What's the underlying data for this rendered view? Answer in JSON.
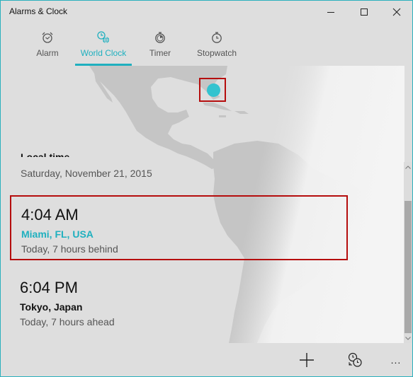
{
  "window": {
    "title": "Alarms & Clock",
    "controls": {
      "minimize": "minimize-icon",
      "maximize": "maximize-icon",
      "close": "close-icon"
    }
  },
  "tabs": [
    {
      "label": "Alarm",
      "icon": "alarm-clock-icon",
      "active": false
    },
    {
      "label": "World Clock",
      "icon": "world-clock-icon",
      "active": true
    },
    {
      "label": "Timer",
      "icon": "timer-icon",
      "active": false
    },
    {
      "label": "Stopwatch",
      "icon": "stopwatch-icon",
      "active": false
    }
  ],
  "map": {
    "marker_city": "Miami, FL, USA",
    "marker_color": "#33c3cf"
  },
  "local": {
    "label": "Local time",
    "date": "Saturday, November 21, 2015"
  },
  "clocks": [
    {
      "time": "4:04 AM",
      "city": "Miami, FL, USA",
      "relative": "Today, 7 hours behind",
      "selected": true
    },
    {
      "time": "6:04 PM",
      "city": "Tokyo, Japan",
      "relative": "Today, 7 hours ahead",
      "selected": false
    }
  ],
  "commands": {
    "add": "add-icon",
    "compare": "compare-clocks-icon",
    "more": "..."
  },
  "colors": {
    "accent": "#1fb0bf",
    "selection": "#b50d0d",
    "background": "#dedede"
  }
}
